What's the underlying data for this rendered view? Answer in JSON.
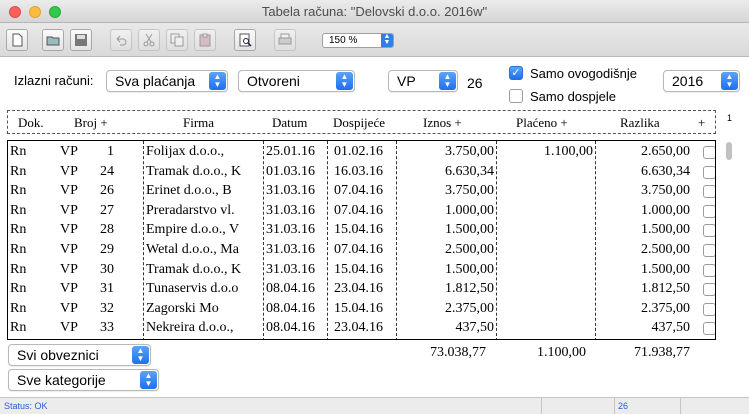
{
  "window": {
    "title": "Tabela računa: \"Delovski d.o.o. 2016w\""
  },
  "toolbar": {
    "buttons": [
      "new-document-icon",
      "open-folder-icon",
      "save-disk-icon",
      "undo-icon",
      "cut-icon",
      "copy-icon",
      "paste-icon",
      "print-preview-icon",
      "print-icon"
    ],
    "zoom": "150 %"
  },
  "filters": {
    "label": "Izlazni računi:",
    "payment": "Sva plaćanja",
    "state": "Otvoreni",
    "type": "VP",
    "type_count": "26",
    "cb_this_year": {
      "label": "Samo ovogodišnje",
      "checked": true
    },
    "cb_due": {
      "label": "Samo dospjele",
      "checked": false
    },
    "year": "2016"
  },
  "table": {
    "headers": [
      "Dok.",
      "Broj +",
      "Firma",
      "Datum",
      "Dospijeće",
      "Iznos +",
      "Plaćeno +",
      "Razlika",
      "+"
    ],
    "side_mark": "1",
    "rows": [
      [
        "Rn",
        "VP",
        "1",
        "Folijax d.o.o.,",
        "25.01.16",
        "01.02.16",
        "3.750,00",
        "1.100,00",
        "2.650,00"
      ],
      [
        "Rn",
        "VP",
        "24",
        "Tramak d.o.o., K",
        "01.03.16",
        "16.03.16",
        "6.630,34",
        "",
        "6.630,34"
      ],
      [
        "Rn",
        "VP",
        "26",
        "Erinet d.o.o., B",
        "31.03.16",
        "07.04.16",
        "3.750,00",
        "",
        "3.750,00"
      ],
      [
        "Rn",
        "VP",
        "27",
        "Preradarstvo vl.",
        "31.03.16",
        "07.04.16",
        "1.000,00",
        "",
        "1.000,00"
      ],
      [
        "Rn",
        "VP",
        "28",
        "Empire d.o.o., V",
        "31.03.16",
        "15.04.16",
        "1.500,00",
        "",
        "1.500,00"
      ],
      [
        "Rn",
        "VP",
        "29",
        "Wetal d.o.o., Ma",
        "31.03.16",
        "07.04.16",
        "2.500,00",
        "",
        "2.500,00"
      ],
      [
        "Rn",
        "VP",
        "30",
        "Tramak d.o.o., K",
        "31.03.16",
        "15.04.16",
        "1.500,00",
        "",
        "1.500,00"
      ],
      [
        "Rn",
        "VP",
        "31",
        "Tunaservis d.o.o",
        "08.04.16",
        "23.04.16",
        "1.812,50",
        "",
        "1.812,50"
      ],
      [
        "Rn",
        "VP",
        "32",
        "Zagorski Mo",
        "08.04.16",
        "15.04.16",
        "2.375,00",
        "",
        "2.375,00"
      ],
      [
        "Rn",
        "VP",
        "33",
        "Nekreira d.o.o.,",
        "08.04.16",
        "23.04.16",
        "437,50",
        "",
        "437,50"
      ]
    ],
    "totals": {
      "iznos": "73.038,77",
      "placeno": "1.100,00",
      "razlika": "71.938,77"
    }
  },
  "bottom": {
    "partners": "Svi obveznici",
    "categories": "Sve kategorije"
  },
  "statusbar": {
    "status": "Status: OK",
    "count": "26"
  }
}
